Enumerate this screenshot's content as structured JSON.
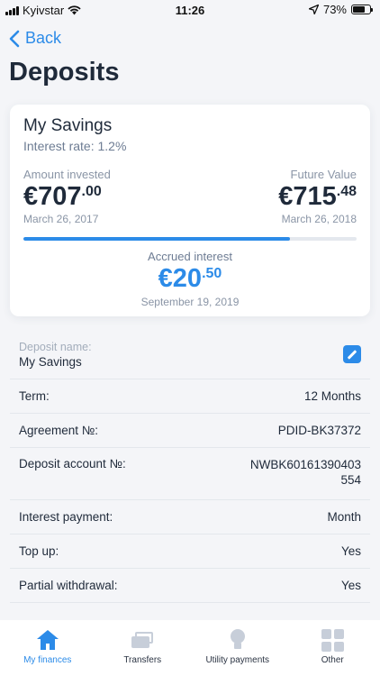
{
  "status_bar": {
    "carrier": "Kyivstar",
    "time": "11:26",
    "battery": "73%"
  },
  "nav": {
    "back_label": "Back",
    "title": "Deposits"
  },
  "card": {
    "title": "My Savings",
    "interest_rate": "Interest rate: 1.2%",
    "invested_label": "Amount invested",
    "invested_main": "€707",
    "invested_cents": ".00",
    "invested_date": "March 26, 2017",
    "future_label": "Future Value",
    "future_main": "€715",
    "future_cents": ".48",
    "future_date": "March 26, 2018",
    "progress_fraction": 0.8,
    "accrued_label": "Accrued interest",
    "accrued_main": "€20",
    "accrued_cents": ".50",
    "accrued_date": "September 19, 2019"
  },
  "details": {
    "deposit_name_label": "Deposit name:",
    "deposit_name_value": "My Savings",
    "rows": [
      {
        "label": "Term:",
        "value": "12 Months"
      },
      {
        "label": "Agreement №:",
        "value": "PDID-BK37372"
      },
      {
        "label": "Deposit account №:",
        "value": "NWBK60161390403554"
      },
      {
        "label": "Interest payment:",
        "value": "Month"
      },
      {
        "label": "Top up:",
        "value": "Yes"
      },
      {
        "label": "Partial withdrawal:",
        "value": "Yes"
      }
    ]
  },
  "tabbar": {
    "tabs": [
      {
        "label": "My finances",
        "icon": "home-icon",
        "active": true
      },
      {
        "label": "Transfers",
        "icon": "cards-icon"
      },
      {
        "label": "Utility payments",
        "icon": "lightbulb-icon"
      },
      {
        "label": "Other",
        "icon": "grid-icon"
      }
    ]
  },
  "colors": {
    "accent": "#2c8be8",
    "text": "#1f2a3a",
    "muted": "#8a95a6",
    "background": "#f4f5f8"
  }
}
